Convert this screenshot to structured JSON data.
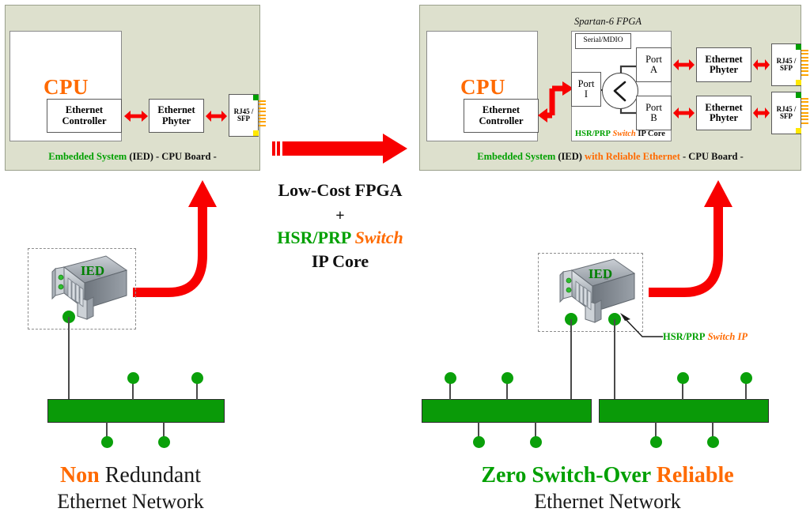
{
  "left_panel": {
    "cpu_label": "CPU",
    "ethernet_controller": "Ethernet\nController",
    "ethernet_phyter": "Ethernet\nPhyter",
    "rj45": "RJ45 /\nSFP",
    "caption": {
      "green": "Embedded System",
      "black": " (IED) - CPU Board -"
    }
  },
  "right_panel": {
    "cpu_label": "CPU",
    "ethernet_controller": "Ethernet\nController",
    "fpga_title": "Spartan-6 FPGA",
    "serial_mdio": "Serial/MDIO",
    "port_i": "Port\nI",
    "port_a": "Port\nA",
    "port_b": "Port\nB",
    "ip_core": {
      "green": "HSR/PRP",
      "orange": " Switch",
      "black": " IP Core"
    },
    "ethernet_phyter_top": "Ethernet\nPhyter",
    "ethernet_phyter_bottom": "Ethernet\nPhyter",
    "rj45_top": "RJ45 /\nSFP",
    "rj45_bottom": "RJ45 /\nSFP",
    "caption": {
      "green": "Embedded System",
      "black1": " (IED) ",
      "orange": "with Reliable Ethernet",
      "black2": " - CPU Board -"
    }
  },
  "center": {
    "line1": "Low-Cost FPGA",
    "line2": "+",
    "line3_green": "HSR/PRP",
    "line3_orange": "Switch",
    "line4": "IP Core"
  },
  "bottom_left": {
    "ied_label": "IED",
    "caption_highlight": "Non",
    "caption_rest": " Redundant",
    "caption_line2": "Ethernet Network"
  },
  "bottom_right": {
    "ied_label": "IED",
    "annotation_green": "HSR/PRP",
    "annotation_orange": " Switch IP",
    "caption_green": "Zero Switch-Over",
    "caption_orange": " Reliable",
    "caption_line2": "Ethernet Network"
  },
  "colors": {
    "board_fill": "#dde0cd",
    "board_border": "#9aa08c",
    "green": "#00a000",
    "orange": "#ff6a00",
    "red_arrow": "#f80000",
    "bus_green": "#0a9a08",
    "node_green": "#0aa00a"
  },
  "chart_data": null
}
